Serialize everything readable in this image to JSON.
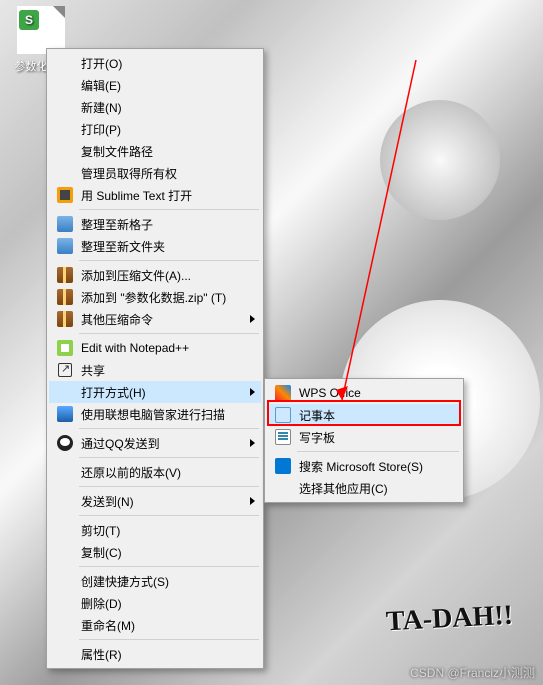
{
  "desktop": {
    "file_label": "参数化...sv",
    "file_badge": "S"
  },
  "manga_sfx": "TA-DAH!!",
  "menu": {
    "items": [
      {
        "icon": "",
        "label": "打开(O)"
      },
      {
        "icon": "",
        "label": "编辑(E)"
      },
      {
        "icon": "",
        "label": "新建(N)"
      },
      {
        "icon": "",
        "label": "打印(P)"
      },
      {
        "icon": "",
        "label": "复制文件路径"
      },
      {
        "icon": "",
        "label": "管理员取得所有权"
      },
      {
        "icon": "sublime",
        "label": "用 Sublime Text 打开"
      }
    ],
    "group2": [
      {
        "icon": "folder",
        "label": "整理至新格子"
      },
      {
        "icon": "folder",
        "label": "整理至新文件夹"
      }
    ],
    "group3": [
      {
        "icon": "zip",
        "label": "添加到压缩文件(A)..."
      },
      {
        "icon": "zip",
        "label": "添加到 \"参数化数据.zip\" (T)"
      },
      {
        "icon": "zip",
        "label": "其他压缩命令",
        "submenu": true
      }
    ],
    "group4": [
      {
        "icon": "npp",
        "label": "Edit with Notepad++"
      },
      {
        "icon": "share",
        "label": "共享"
      },
      {
        "icon": "",
        "label": "打开方式(H)",
        "submenu": true,
        "highlight": true
      },
      {
        "icon": "scan",
        "label": "使用联想电脑管家进行扫描"
      }
    ],
    "group5": [
      {
        "icon": "qq",
        "label": "通过QQ发送到",
        "submenu": true
      }
    ],
    "group6": [
      {
        "icon": "",
        "label": "还原以前的版本(V)"
      }
    ],
    "group7": [
      {
        "icon": "",
        "label": "发送到(N)",
        "submenu": true
      }
    ],
    "group8": [
      {
        "icon": "",
        "label": "剪切(T)"
      },
      {
        "icon": "",
        "label": "复制(C)"
      }
    ],
    "group9": [
      {
        "icon": "",
        "label": "创建快捷方式(S)"
      },
      {
        "icon": "",
        "label": "删除(D)"
      },
      {
        "icon": "",
        "label": "重命名(M)"
      }
    ],
    "group10": [
      {
        "icon": "",
        "label": "属性(R)"
      }
    ]
  },
  "submenu": {
    "items": [
      {
        "icon": "wps",
        "label": "WPS Office"
      },
      {
        "icon": "notepad",
        "label": "记事本",
        "highlight": true
      },
      {
        "icon": "wordpad",
        "label": "写字板"
      }
    ],
    "group2": [
      {
        "icon": "store",
        "label": "搜索 Microsoft Store(S)"
      },
      {
        "icon": "",
        "label": "选择其他应用(C)"
      }
    ]
  },
  "watermark": "CSDN @Franciz小测测"
}
